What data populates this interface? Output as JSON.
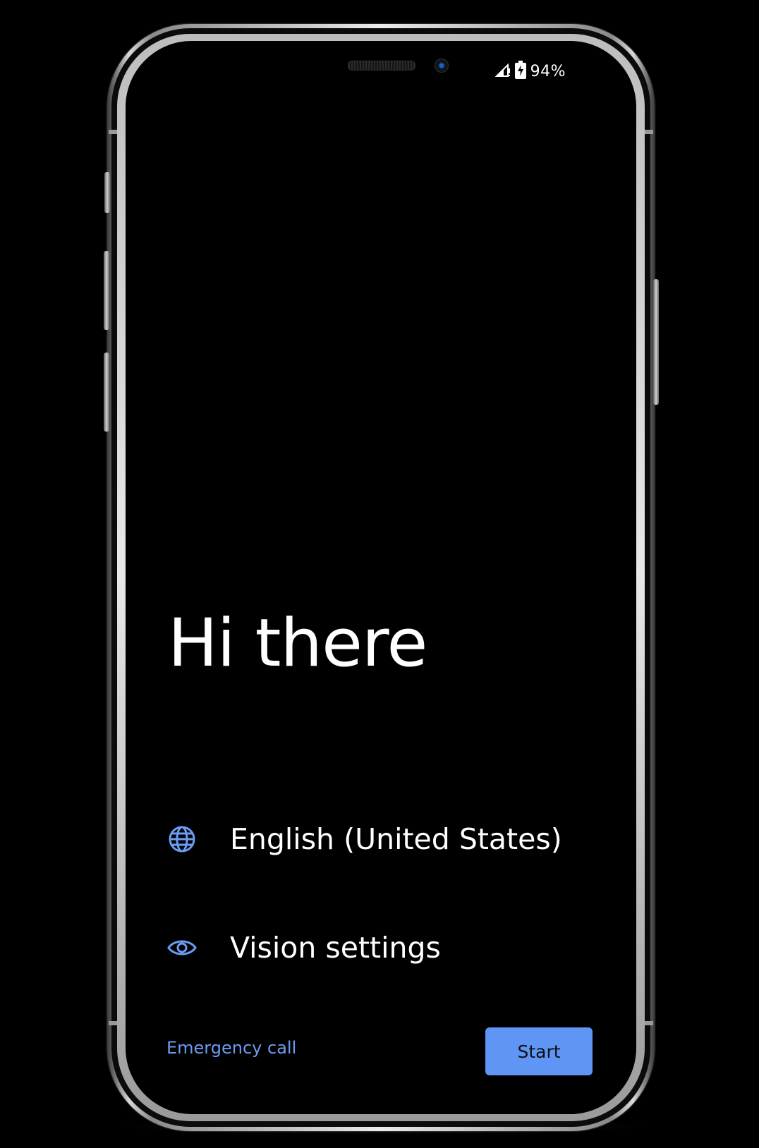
{
  "status_bar": {
    "battery_percent": "94%",
    "icons": [
      "signal-no-data-icon",
      "battery-charging-icon"
    ]
  },
  "welcome": {
    "title": "Hi there",
    "language_label": "English (United States)",
    "language_icon": "globe-icon",
    "vision_label": "Vision settings",
    "vision_icon": "eye-icon"
  },
  "footer": {
    "emergency_label": "Emergency call",
    "start_label": "Start"
  },
  "colors": {
    "accent": "#5f96f5",
    "link": "#6c9cf2",
    "background": "#000000",
    "text": "#ffffff"
  }
}
